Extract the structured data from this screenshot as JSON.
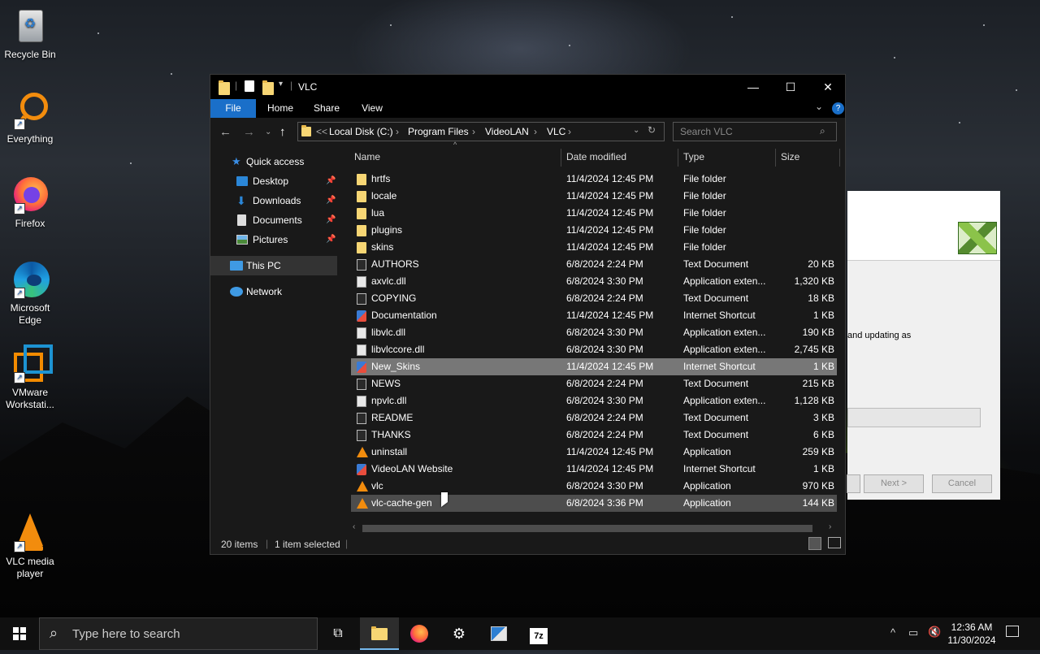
{
  "desktop": {
    "icons": [
      {
        "label": "Recycle Bin",
        "icon": "recycle-bin-icon"
      },
      {
        "label": "Everything",
        "icon": "everything-search-icon"
      },
      {
        "label": "Firefox",
        "icon": "firefox-icon"
      },
      {
        "label": "Microsoft Edge",
        "icon": "edge-icon"
      },
      {
        "label": "VMware Workstati...",
        "icon": "vmware-icon"
      },
      {
        "label": "VLC media player",
        "icon": "vlc-icon"
      }
    ]
  },
  "installer_dialog": {
    "partial_text": "and updating as",
    "next_label": "Next >",
    "cancel_label": "Cancel"
  },
  "explorer": {
    "title": "VLC",
    "ribbon_tabs": [
      "File",
      "Home",
      "Share",
      "View"
    ],
    "breadcrumb": [
      "Local Disk (C:)",
      "Program Files",
      "VideoLAN",
      "VLC"
    ],
    "breadcrumb_overflow": "<<",
    "search_placeholder": "Search VLC",
    "nav": {
      "quick_access": "Quick access",
      "pinned": [
        "Desktop",
        "Downloads",
        "Documents",
        "Pictures"
      ],
      "this_pc": "This PC",
      "network": "Network"
    },
    "columns": [
      "Name",
      "Date modified",
      "Type",
      "Size"
    ],
    "files": [
      {
        "name": "hrtfs",
        "date": "11/4/2024 12:45 PM",
        "type": "File folder",
        "size": "",
        "kind": "folder"
      },
      {
        "name": "locale",
        "date": "11/4/2024 12:45 PM",
        "type": "File folder",
        "size": "",
        "kind": "folder"
      },
      {
        "name": "lua",
        "date": "11/4/2024 12:45 PM",
        "type": "File folder",
        "size": "",
        "kind": "folder"
      },
      {
        "name": "plugins",
        "date": "11/4/2024 12:45 PM",
        "type": "File folder",
        "size": "",
        "kind": "folder"
      },
      {
        "name": "skins",
        "date": "11/4/2024 12:45 PM",
        "type": "File folder",
        "size": "",
        "kind": "folder"
      },
      {
        "name": "AUTHORS",
        "date": "6/8/2024 2:24 PM",
        "type": "Text Document",
        "size": "20 KB",
        "kind": "text"
      },
      {
        "name": "axvlc.dll",
        "date": "6/8/2024 3:30 PM",
        "type": "Application exten...",
        "size": "1,320 KB",
        "kind": "dll"
      },
      {
        "name": "COPYING",
        "date": "6/8/2024 2:24 PM",
        "type": "Text Document",
        "size": "18 KB",
        "kind": "text"
      },
      {
        "name": "Documentation",
        "date": "11/4/2024 12:45 PM",
        "type": "Internet Shortcut",
        "size": "1 KB",
        "kind": "url"
      },
      {
        "name": "libvlc.dll",
        "date": "6/8/2024 3:30 PM",
        "type": "Application exten...",
        "size": "190 KB",
        "kind": "dll"
      },
      {
        "name": "libvlccore.dll",
        "date": "6/8/2024 3:30 PM",
        "type": "Application exten...",
        "size": "2,745 KB",
        "kind": "dll"
      },
      {
        "name": "New_Skins",
        "date": "11/4/2024 12:45 PM",
        "type": "Internet Shortcut",
        "size": "1 KB",
        "kind": "url"
      },
      {
        "name": "NEWS",
        "date": "6/8/2024 2:24 PM",
        "type": "Text Document",
        "size": "215 KB",
        "kind": "text"
      },
      {
        "name": "npvlc.dll",
        "date": "6/8/2024 3:30 PM",
        "type": "Application exten...",
        "size": "1,128 KB",
        "kind": "dll"
      },
      {
        "name": "README",
        "date": "6/8/2024 2:24 PM",
        "type": "Text Document",
        "size": "3 KB",
        "kind": "text"
      },
      {
        "name": "THANKS",
        "date": "6/8/2024 2:24 PM",
        "type": "Text Document",
        "size": "6 KB",
        "kind": "text"
      },
      {
        "name": "uninstall",
        "date": "11/4/2024 12:45 PM",
        "type": "Application",
        "size": "259 KB",
        "kind": "vlc"
      },
      {
        "name": "VideoLAN Website",
        "date": "11/4/2024 12:45 PM",
        "type": "Internet Shortcut",
        "size": "1 KB",
        "kind": "url"
      },
      {
        "name": "vlc",
        "date": "6/8/2024 3:30 PM",
        "type": "Application",
        "size": "970 KB",
        "kind": "vlc"
      },
      {
        "name": "vlc-cache-gen",
        "date": "6/8/2024 3:36 PM",
        "type": "Application",
        "size": "144 KB",
        "kind": "vlc"
      }
    ],
    "selected_row": "New_Skins",
    "hovered_row": "vlc-cache-gen",
    "status_count": "20 items",
    "status_selected": "1 item selected"
  },
  "taskbar": {
    "search_placeholder": "Type here to search",
    "time": "12:36 AM",
    "date": "11/30/2024"
  }
}
